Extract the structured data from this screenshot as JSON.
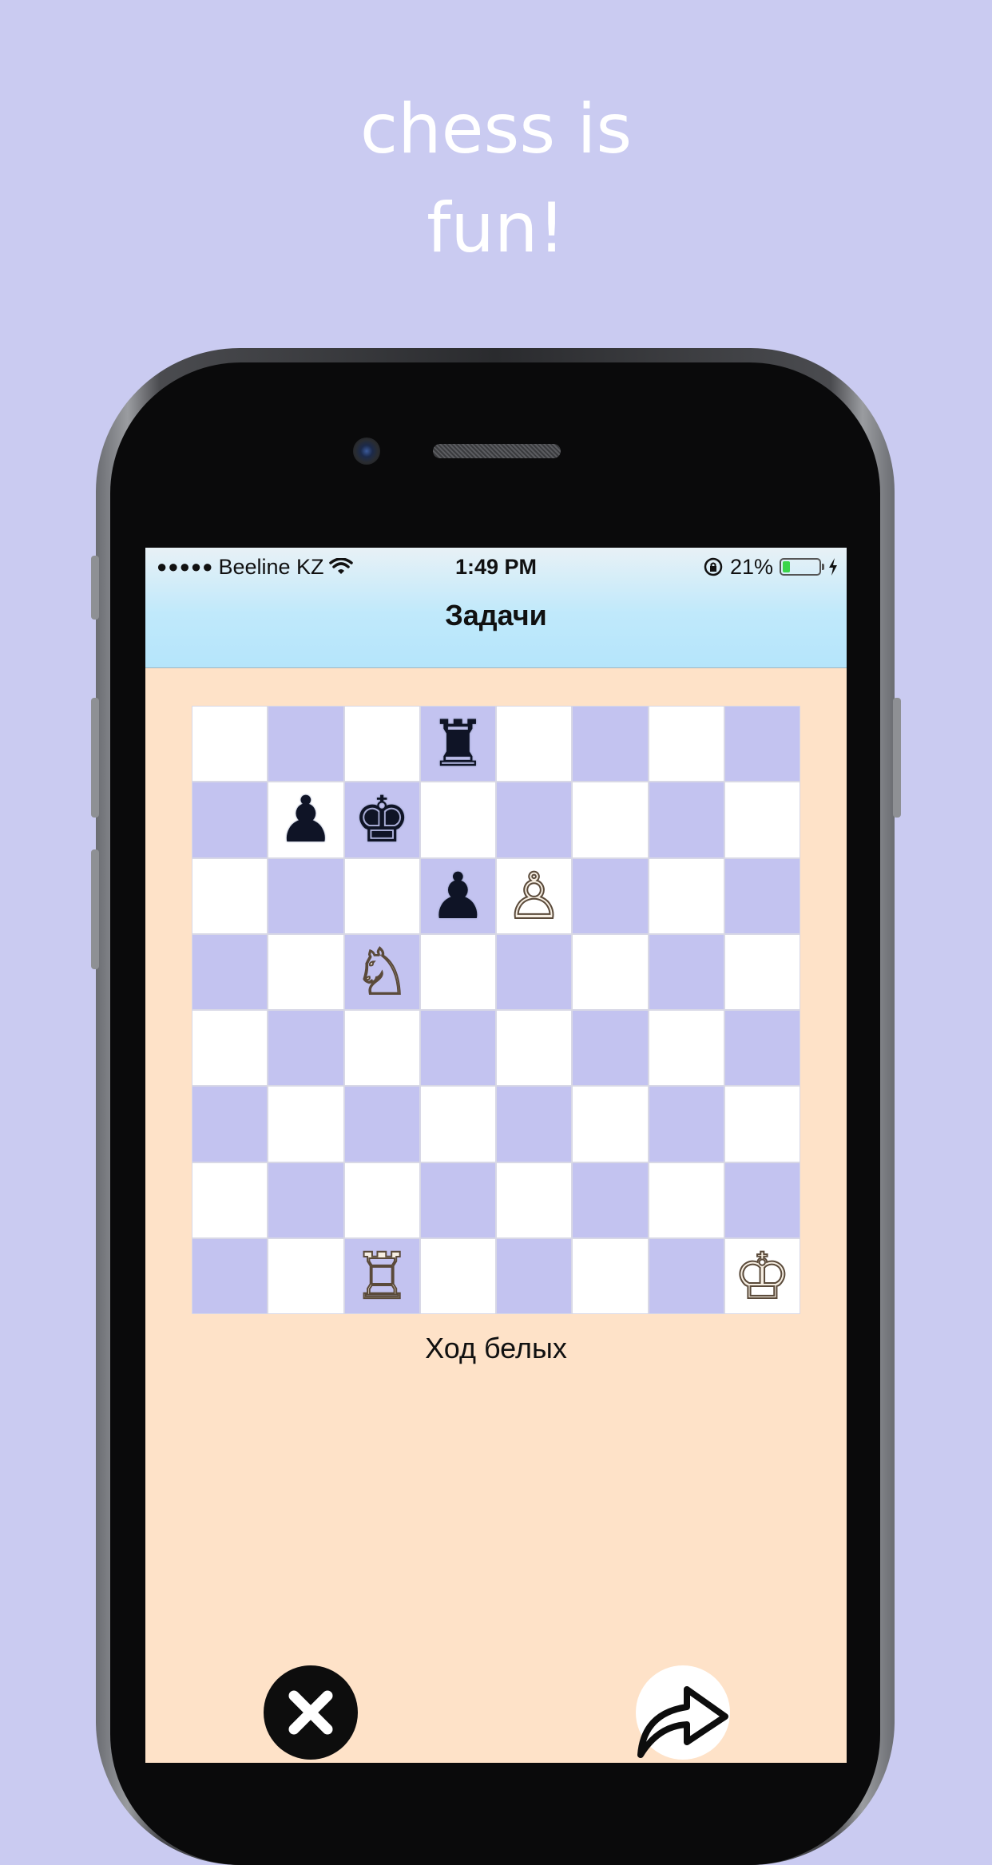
{
  "headline": {
    "line1": "chess is",
    "line2": "fun!"
  },
  "status_bar": {
    "signal_dots": "●●●●●",
    "carrier": "Beeline KZ",
    "time": "1:49 PM",
    "battery_percent": "21%",
    "battery_level": 0.21,
    "battery_color": "#3bd54a"
  },
  "nav": {
    "title": "Задачи"
  },
  "board": {
    "light_color": "#ffffff",
    "dark_color": "#c3c3f0",
    "pieces": [
      {
        "square": "d8",
        "type": "rook",
        "color": "black",
        "glyph": "♜"
      },
      {
        "square": "b7",
        "type": "pawn",
        "color": "black",
        "glyph": "♟"
      },
      {
        "square": "c7",
        "type": "king",
        "color": "black",
        "glyph": "♚"
      },
      {
        "square": "d6",
        "type": "pawn",
        "color": "black",
        "glyph": "♟"
      },
      {
        "square": "e6",
        "type": "pawn",
        "color": "white",
        "glyph": "♙"
      },
      {
        "square": "c5",
        "type": "knight",
        "color": "white",
        "glyph": "♘"
      },
      {
        "square": "c1",
        "type": "rook",
        "color": "white",
        "glyph": "♖"
      },
      {
        "square": "h1",
        "type": "king",
        "color": "white",
        "glyph": "♔"
      }
    ]
  },
  "caption": "Ход белых",
  "buttons": {
    "close_icon": "close-icon",
    "share_icon": "share-arrow-icon"
  },
  "colors": {
    "page_background": "#cacbf1",
    "screen_background": "#fee2c8"
  }
}
